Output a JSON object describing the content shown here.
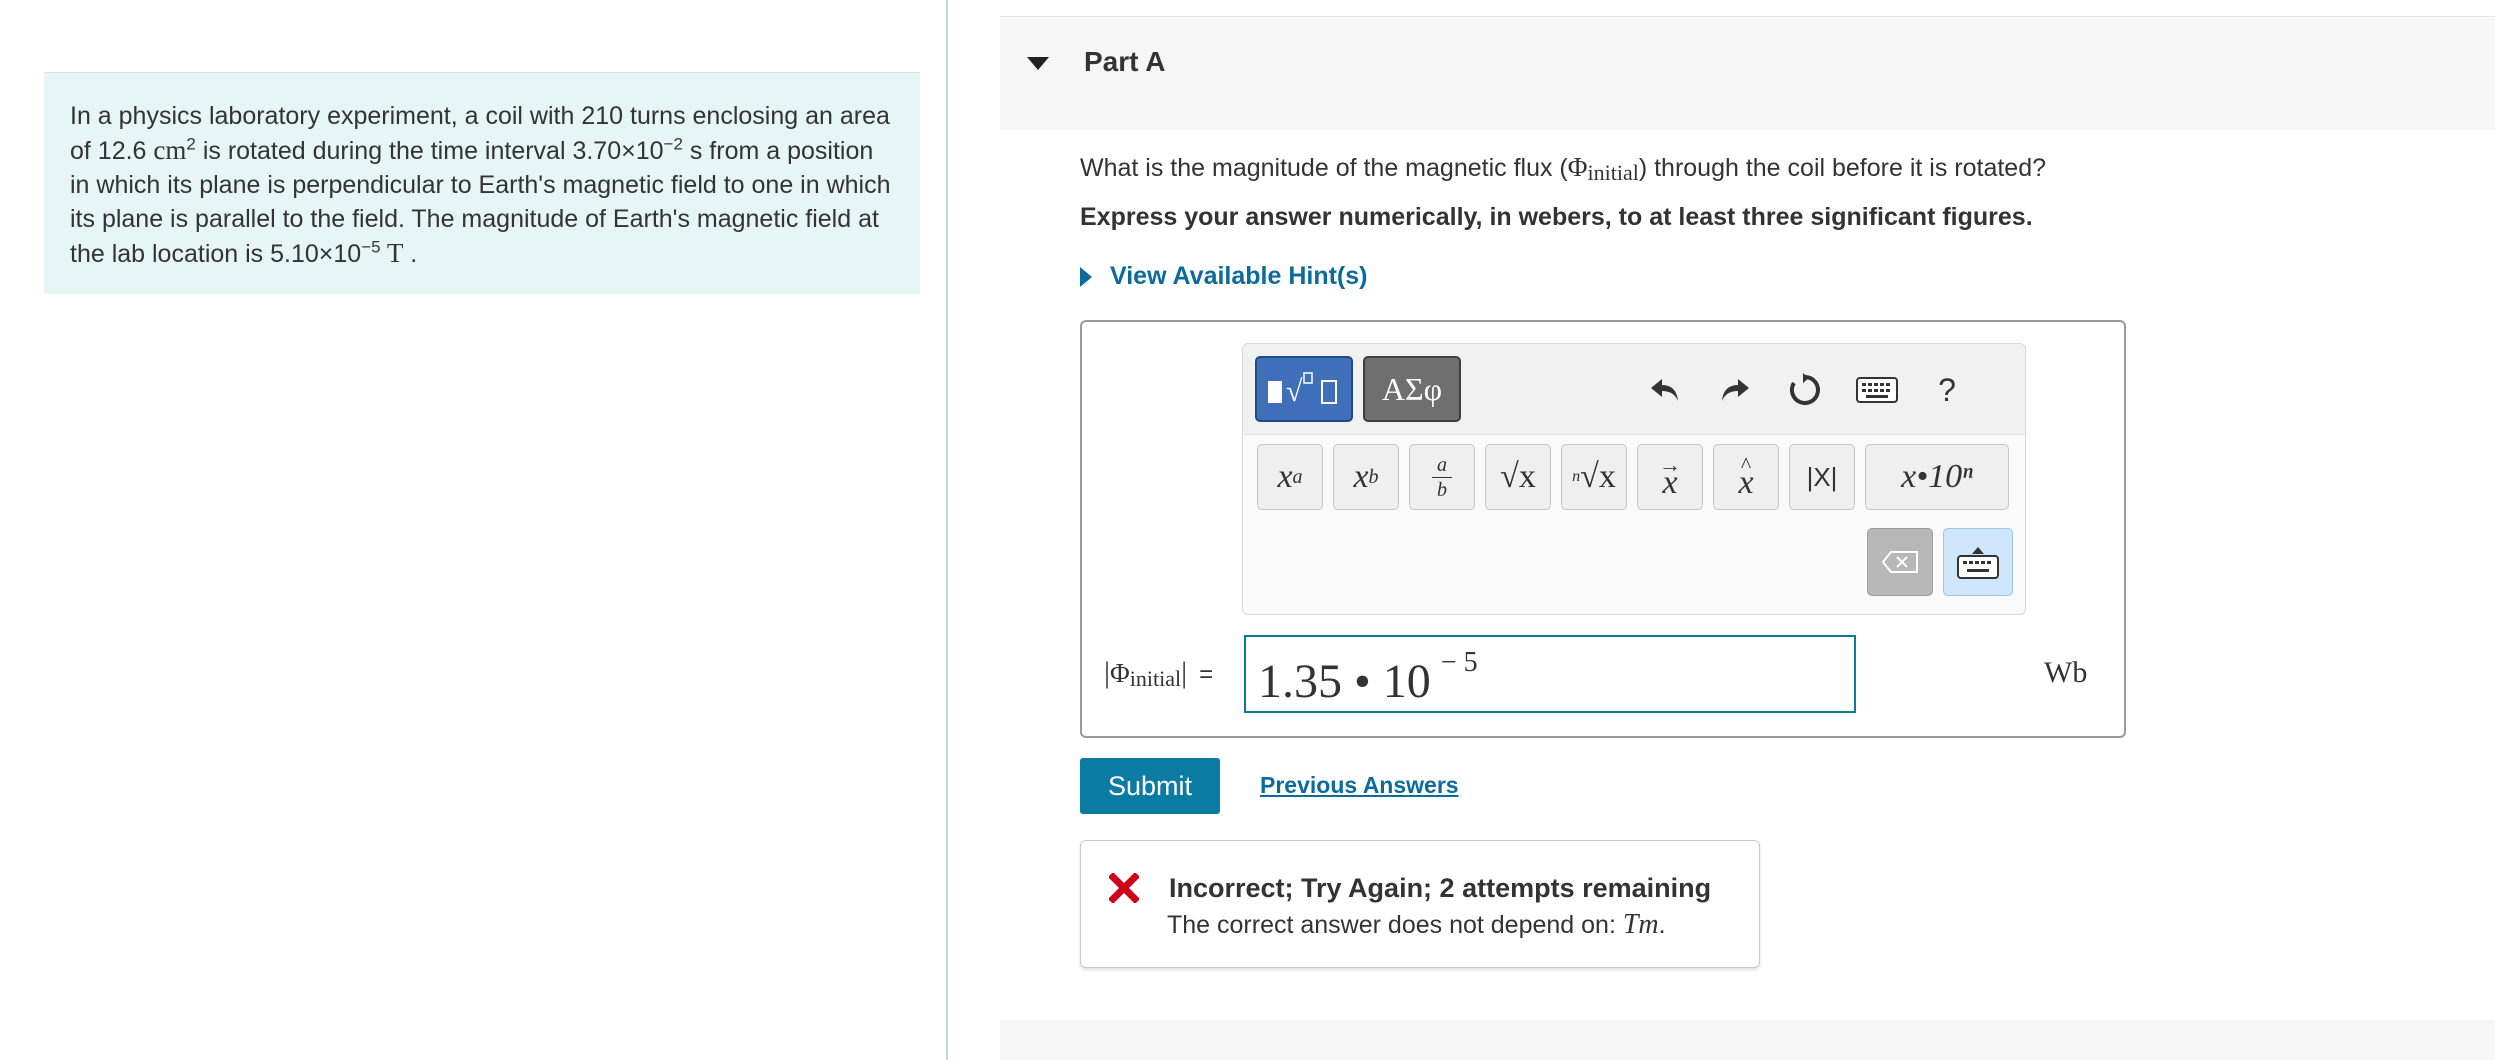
{
  "problem": {
    "text_1": "In a physics laboratory experiment, a coil with 210 turns enclosing an area of 12.6 ",
    "area_unit": "cm",
    "area_exp": "2",
    "text_2": " is rotated during the time interval 3.70×10",
    "time_exp": "−2",
    "text_3": " s from a position in which its plane is perpendicular to Earth's magnetic field to one in which its plane is parallel to the field. The magnitude of Earth's magnetic field at the lab location is 5.10×10",
    "field_exp": "−5",
    "field_unit": " T",
    "text_4": " ."
  },
  "part": {
    "title": "Part A",
    "question_prefix": "What is the magnitude of the magnetic flux (",
    "question_symbol": "Φ",
    "question_sub": "initial",
    "question_suffix": ") through the coil before it is rotated?",
    "instructions": "Express your answer numerically, in webers, to at least three significant figures.",
    "hints_label": "View Available Hint(s)"
  },
  "toolbar": {
    "greek_label": "ΑΣφ",
    "help_label": "?",
    "keys": {
      "superscript": {
        "base": "x",
        "exp": "a"
      },
      "subscript": {
        "base": "x",
        "sub": "b"
      },
      "fraction": {
        "num": "a",
        "den": "b"
      },
      "sqrt": "√x",
      "nthroot": {
        "index": "n",
        "body": "√x"
      },
      "vector": "x",
      "unit_vector": "x",
      "abs": "|X|",
      "scientific": "x•10ⁿ"
    }
  },
  "answer": {
    "label_symbol": "Φ",
    "label_sub": "initial",
    "label_eq": "=",
    "value_mantissa": "1.35 • 10",
    "value_exponent": "− 5",
    "unit": "Wb"
  },
  "actions": {
    "submit_label": "Submit",
    "previous_label": "Previous Answers"
  },
  "feedback": {
    "title": "Incorrect; Try Again; 2 attempts remaining",
    "text_prefix": "The correct answer does not depend on: ",
    "variable": "Tm",
    "text_suffix": "."
  },
  "colors": {
    "accent": "#0a7ba3",
    "link": "#0b6b9d",
    "problem_bg": "#e6f5f5",
    "error": "#d0021b"
  }
}
